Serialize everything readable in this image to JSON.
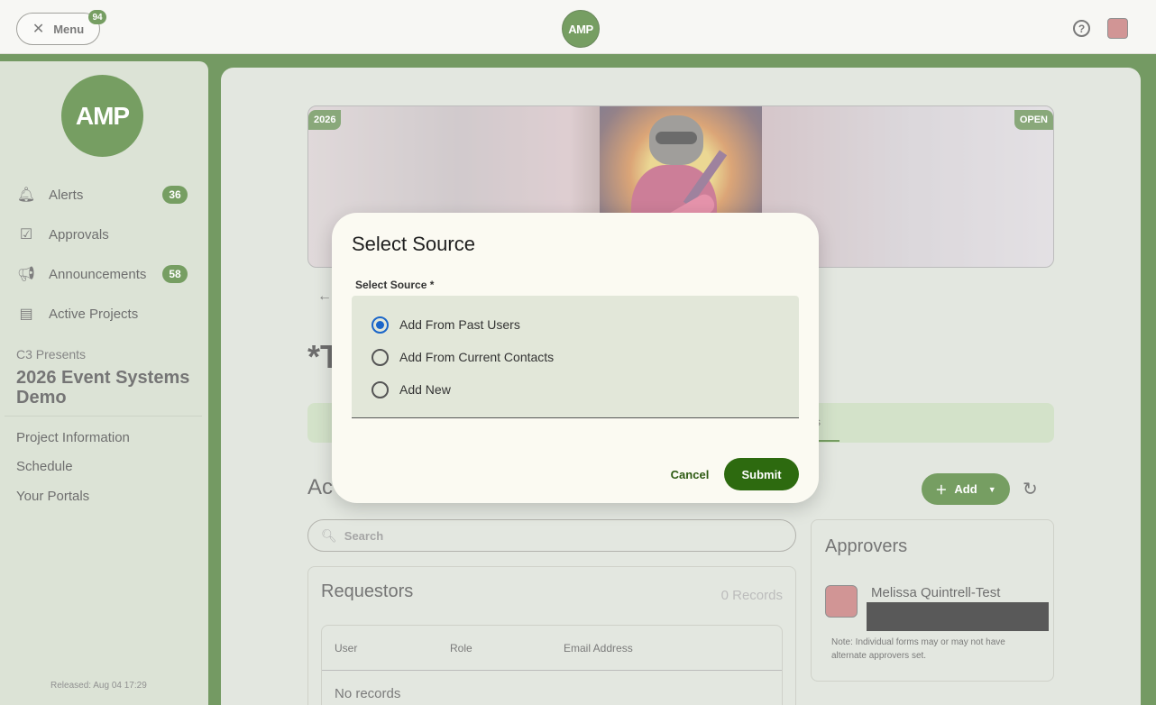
{
  "topbar": {
    "menu_label": "Menu",
    "menu_badge": "94",
    "logo_text": "AMP"
  },
  "sidebar": {
    "logo_text": "AMP",
    "nav": [
      {
        "label": "Alerts",
        "badge": "36",
        "icon": "bell-icon"
      },
      {
        "label": "Approvals",
        "badge": "",
        "icon": "clipboard-check-icon"
      },
      {
        "label": "Announcements",
        "badge": "58",
        "icon": "megaphone-icon"
      },
      {
        "label": "Active Projects",
        "badge": "",
        "icon": "calendar-eye-icon"
      }
    ],
    "presenter": "C3 Presents",
    "project_title": "2026 Event Systems Demo",
    "links": [
      "Project Information",
      "Schedule",
      "Your Portals"
    ],
    "released": "Released: Aug 04 17:29"
  },
  "main": {
    "banner_year": "2026",
    "banner_status": "OPEN",
    "page_heading_visible": "*T",
    "tab_tail": "s",
    "section_heading_visible": "Ac",
    "add_label": "Add",
    "search_placeholder": "Search",
    "requestors": {
      "title": "Requestors",
      "count": "0 Records",
      "columns": [
        "User",
        "Role",
        "Email Address"
      ],
      "empty_text": "No records"
    },
    "approvers": {
      "title": "Approvers",
      "name": "Melissa Quintrell-Test",
      "note": "Note: Individual forms may or may not have alternate approvers set."
    }
  },
  "dialog": {
    "title": "Select Source",
    "field_label": "Select Source *",
    "options": [
      "Add From Past Users",
      "Add From Current Contacts",
      "Add New"
    ],
    "selected_index": 0,
    "cancel_label": "Cancel",
    "submit_label": "Submit"
  },
  "colors": {
    "brand_green": "#2d6a0f",
    "radio_blue": "#1b66c9"
  }
}
